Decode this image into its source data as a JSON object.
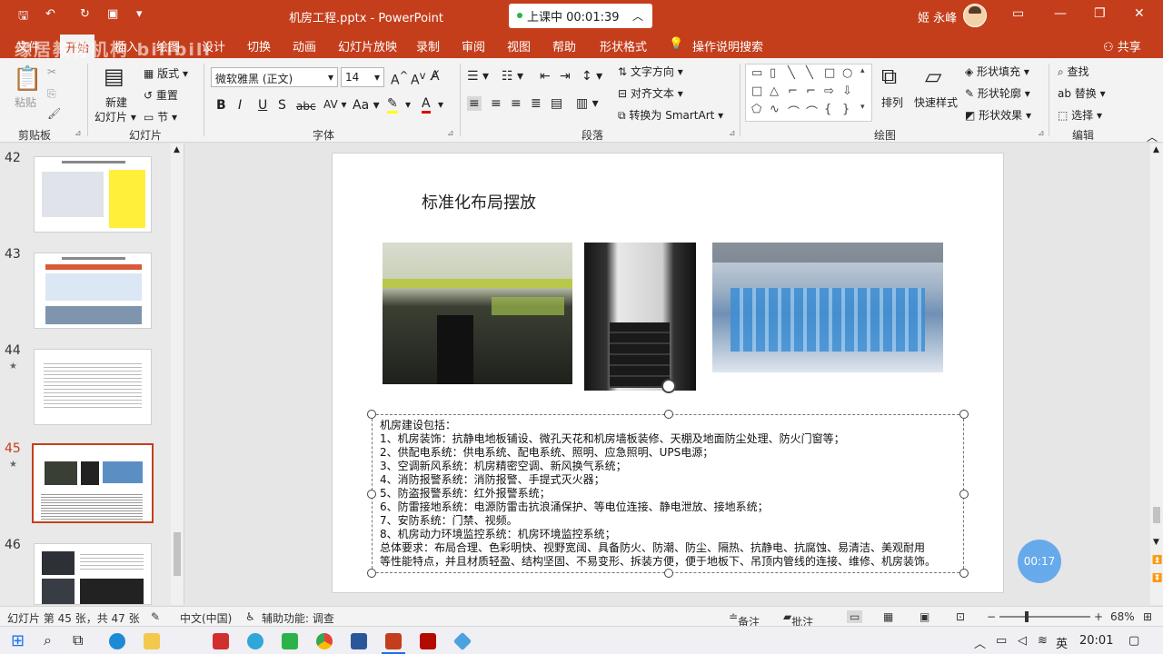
{
  "window": {
    "doc_title": "机房工程.pptx  -  PowerPoint",
    "class_status": "上课中 00:01:39",
    "user": "姬 永峰",
    "share": "共享"
  },
  "tabs": [
    "文件",
    "开始",
    "插入",
    "绘图",
    "设计",
    "切换",
    "动画",
    "幻灯片放映",
    "录制",
    "审阅",
    "视图",
    "帮助",
    "形状格式"
  ],
  "tell_me": "操作说明搜索",
  "watermark": "缘居教育机构 bilibili",
  "ribbon": {
    "clipboard": {
      "paste": "粘贴",
      "label": "剪贴板"
    },
    "slides": {
      "new_slide": "新建",
      "new_slide2": "幻灯片",
      "layout": "版式",
      "reset": "重置",
      "section": "节",
      "label": "幻灯片"
    },
    "font": {
      "name": "微软雅黑 (正文)",
      "size": "14",
      "label": "字体"
    },
    "paragraph": {
      "text_direction": "文字方向",
      "align_text": "对齐文本",
      "smartart": "转换为 SmartArt",
      "label": "段落"
    },
    "drawing": {
      "arrange": "排列",
      "quick_styles": "快速样式",
      "fill": "形状填充",
      "outline": "形状轮廓",
      "effects": "形状效果",
      "label": "绘图"
    },
    "editing": {
      "find": "查找",
      "replace": "替换",
      "select": "选择",
      "label": "编辑"
    }
  },
  "thumbnails": [
    {
      "num": "42",
      "star": ""
    },
    {
      "num": "43",
      "star": ""
    },
    {
      "num": "44",
      "star": "★"
    },
    {
      "num": "45",
      "star": "★"
    },
    {
      "num": "46",
      "star": ""
    }
  ],
  "slide": {
    "title": "标准化布局摆放",
    "lines": [
      "机房建设包括：",
      "1、机房装饰：抗静电地板铺设、微孔天花和机房墙板装修、天棚及地面防尘处理、防火门窗等；",
      "2、供配电系统：供电系统、配电系统、照明、应急照明、UPS电源；",
      "3、空调新风系统：机房精密空调、新风换气系统；",
      "4、消防报警系统：消防报警、手提式灭火器；",
      "5、防盗报警系统：红外报警系统；",
      "6、防雷接地系统：电源防雷击抗浪涌保护、等电位连接、静电泄放、接地系统；",
      "7、安防系统：门禁、视频。",
      "8、机房动力环境监控系统：机房环境监控系统；",
      "总体要求：布局合理、色彩明快、视野宽阔、具备防火、防潮、防尘、隔热、抗静电、抗腐蚀、易清洁、美观耐用",
      "等性能特点，并且材质轻盈、结构坚固、不易变形、拆装方便，便于地板下、吊顶内管线的连接、维修、机房装饰。"
    ]
  },
  "timer_badge": "00:17",
  "status": {
    "slide_info": "幻灯片 第 45 张，共 47 张",
    "language": "中文(中国)",
    "accessibility": "辅助功能: 调查",
    "notes": "备注",
    "comments": "批注",
    "zoom": "68%"
  },
  "tray": {
    "ime": "英",
    "time": "20:01"
  },
  "colors": {
    "accent": "#c43e1c"
  }
}
